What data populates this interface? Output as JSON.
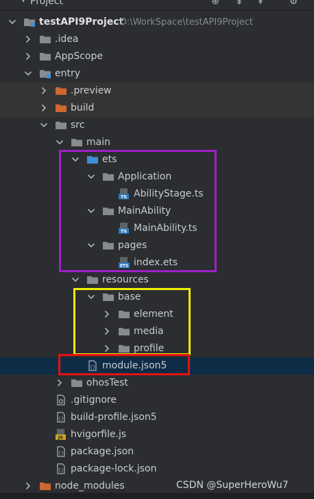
{
  "header": {
    "title": "Project"
  },
  "tree": [
    {
      "depth": 0,
      "label": "testAPI9Project",
      "path": "D:\\WorkSpace\\testAPI9Project",
      "bold": true,
      "icon": "module-folder-icon",
      "chevron": "down"
    },
    {
      "depth": 1,
      "label": ".idea",
      "icon": "folder-icon",
      "chevron": "right"
    },
    {
      "depth": 1,
      "label": "AppScope",
      "icon": "folder-icon",
      "chevron": "right"
    },
    {
      "depth": 1,
      "label": "entry",
      "icon": "module-folder-icon",
      "chevron": "down"
    },
    {
      "depth": 2,
      "label": ".preview",
      "icon": "excluded-folder-icon",
      "chevron": "right",
      "highlight": true
    },
    {
      "depth": 2,
      "label": "build",
      "icon": "excluded-folder-icon",
      "chevron": "right",
      "highlight": true
    },
    {
      "depth": 2,
      "label": "src",
      "icon": "folder-icon",
      "chevron": "down"
    },
    {
      "depth": 3,
      "label": "main",
      "icon": "folder-icon",
      "chevron": "down"
    },
    {
      "depth": 4,
      "label": "ets",
      "icon": "source-folder-icon",
      "chevron": "down"
    },
    {
      "depth": 5,
      "label": "Application",
      "icon": "folder-icon",
      "chevron": "down"
    },
    {
      "depth": 6,
      "label": "AbilityStage.ts",
      "icon": "ts-file-icon",
      "chevron": "none"
    },
    {
      "depth": 5,
      "label": "MainAbility",
      "icon": "folder-icon",
      "chevron": "down"
    },
    {
      "depth": 6,
      "label": "MainAbility.ts",
      "icon": "ts-file-icon",
      "chevron": "none"
    },
    {
      "depth": 5,
      "label": "pages",
      "icon": "folder-icon",
      "chevron": "down"
    },
    {
      "depth": 6,
      "label": "index.ets",
      "icon": "ets-file-icon",
      "chevron": "none"
    },
    {
      "depth": 4,
      "label": "resources",
      "icon": "folder-icon",
      "chevron": "down"
    },
    {
      "depth": 5,
      "label": "base",
      "icon": "folder-icon",
      "chevron": "down"
    },
    {
      "depth": 6,
      "label": "element",
      "icon": "folder-icon",
      "chevron": "right"
    },
    {
      "depth": 6,
      "label": "media",
      "icon": "folder-icon",
      "chevron": "right"
    },
    {
      "depth": 6,
      "label": "profile",
      "icon": "folder-icon",
      "chevron": "right"
    },
    {
      "depth": 4,
      "label": "module.json5",
      "icon": "json-file-icon",
      "chevron": "none",
      "selected": true
    },
    {
      "depth": 3,
      "label": "ohosTest",
      "icon": "folder-icon",
      "chevron": "right"
    },
    {
      "depth": 2,
      "label": ".gitignore",
      "icon": "config-file-icon",
      "chevron": "none"
    },
    {
      "depth": 2,
      "label": "build-profile.json5",
      "icon": "json-file-icon",
      "chevron": "none"
    },
    {
      "depth": 2,
      "label": "hvigorfile.js",
      "icon": "js-file-icon",
      "chevron": "none"
    },
    {
      "depth": 2,
      "label": "package.json",
      "icon": "json-file-icon",
      "chevron": "none"
    },
    {
      "depth": 2,
      "label": "package-lock.json",
      "icon": "json-file-icon",
      "chevron": "none"
    },
    {
      "depth": 1,
      "label": "node_modules",
      "icon": "excluded-folder-icon",
      "chevron": "right"
    }
  ],
  "annotations": [
    {
      "name": "ets-folder-annotation-box",
      "color": "#a020c8"
    },
    {
      "name": "base-folder-annotation-box",
      "color": "#f0f000"
    },
    {
      "name": "module-json5-annotation-box",
      "color": "#e61010"
    }
  ],
  "watermark": "CSDN @SuperHeroWu7"
}
